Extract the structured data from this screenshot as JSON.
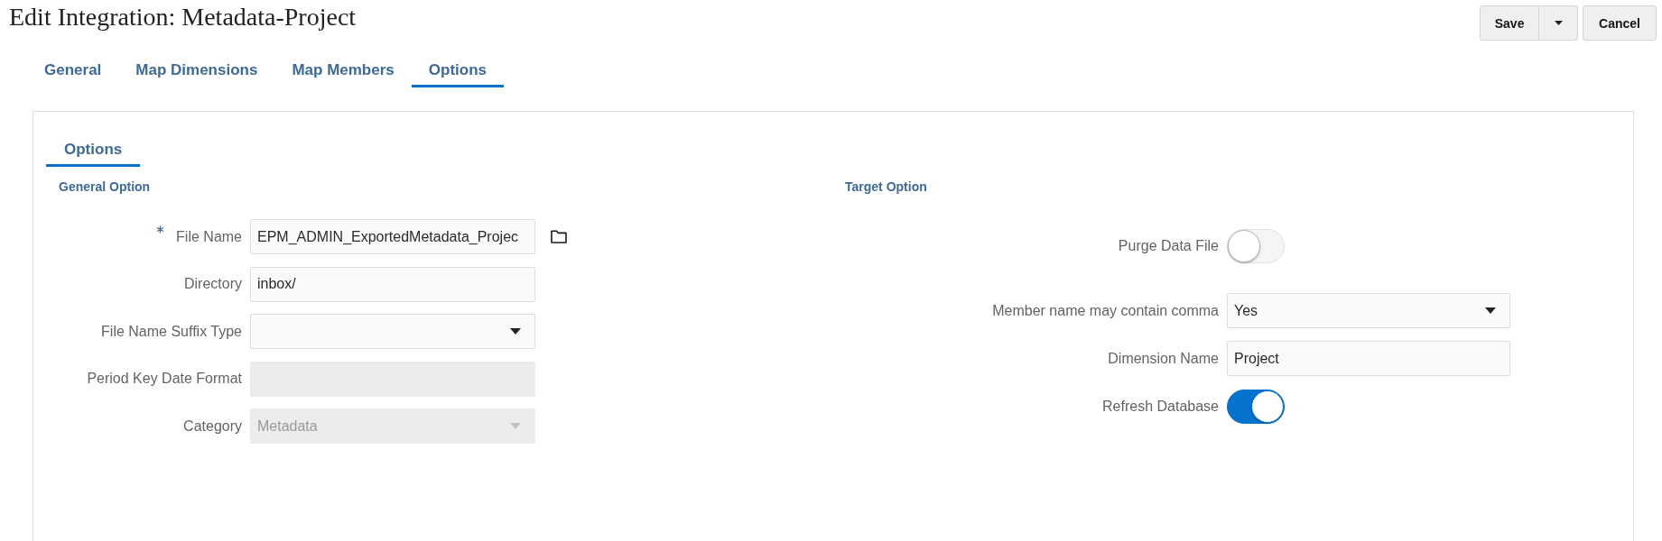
{
  "page": {
    "title": "Edit Integration: Metadata-Project"
  },
  "actions": [
    {
      "kind": "button",
      "label": "Save"
    },
    {
      "kind": "menu"
    },
    {
      "kind": "button",
      "label": "Cancel"
    }
  ],
  "tabs": [
    {
      "label": "General",
      "selected": false
    },
    {
      "label": "Map Dimensions",
      "selected": false
    },
    {
      "label": "Map Members",
      "selected": false
    },
    {
      "label": "Options",
      "selected": true
    }
  ],
  "panel": {
    "tabs": [
      {
        "label": "Options",
        "selected": true
      }
    ],
    "sections": [
      {
        "heading": "General Option",
        "fields": [
          {
            "kind": "text",
            "label": "File Name",
            "value": "EPM_ADMIN_ExportedMetadata_Projec",
            "required": true,
            "disabled": false,
            "browse": true
          },
          {
            "kind": "text",
            "label": "Directory",
            "value": "inbox/",
            "required": false,
            "disabled": false
          },
          {
            "kind": "select",
            "label": "File Name Suffix Type",
            "required": false,
            "disabled": false
          },
          {
            "kind": "text",
            "label": "Period Key Date Format",
            "required": false,
            "disabled": true
          },
          {
            "kind": "select",
            "label": "Category",
            "value": "Metadata",
            "required": false,
            "disabled": true
          }
        ]
      },
      {
        "heading": "Target Option",
        "fields": [
          {
            "kind": "toggle",
            "label": "Purge Data File",
            "on": false,
            "required": false,
            "disabled": false
          },
          {
            "kind": "select",
            "label": "Member name may contain comma",
            "value": "Yes",
            "required": false,
            "disabled": false
          },
          {
            "kind": "text",
            "label": "Dimension Name",
            "value": "Project",
            "required": false,
            "disabled": false
          },
          {
            "kind": "toggle",
            "label": "Refresh Database",
            "on": true,
            "required": false,
            "disabled": false
          }
        ]
      }
    ]
  }
}
